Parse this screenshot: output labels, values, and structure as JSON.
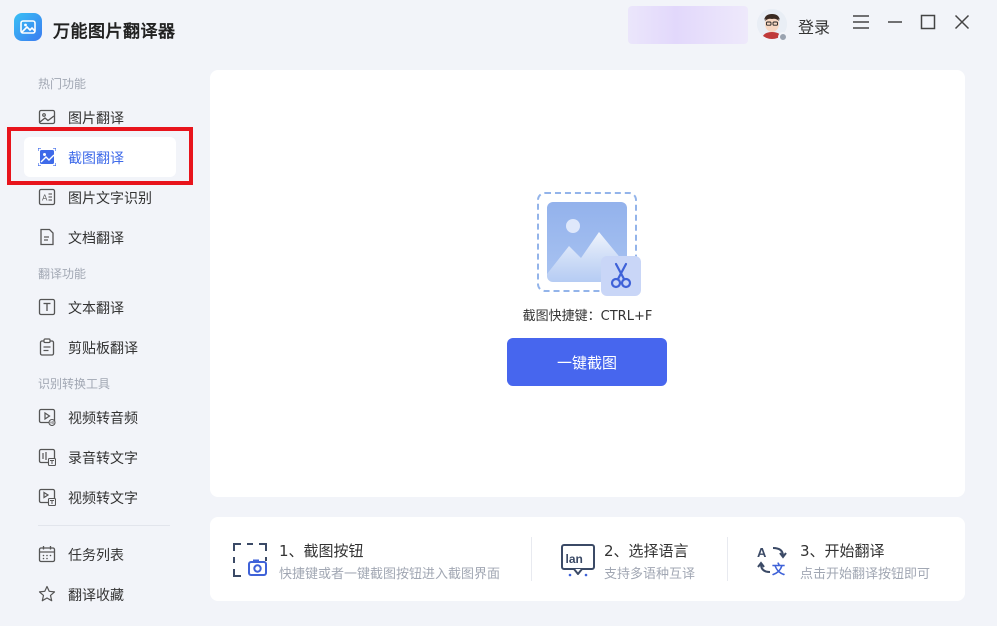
{
  "app": {
    "title": "万能图片翻译器"
  },
  "header": {
    "login_label": "登录"
  },
  "sidebar": {
    "sections": [
      {
        "label": "热门功能"
      },
      {
        "label": "翻译功能"
      },
      {
        "label": "识别转换工具"
      }
    ],
    "items": [
      {
        "label": "图片翻译",
        "icon": "image-icon",
        "active": false
      },
      {
        "label": "截图翻译",
        "icon": "screenshot-icon",
        "active": true
      },
      {
        "label": "图片文字识别",
        "icon": "ocr-icon",
        "active": false
      },
      {
        "label": "文档翻译",
        "icon": "document-icon",
        "active": false
      },
      {
        "label": "文本翻译",
        "icon": "text-icon",
        "active": false
      },
      {
        "label": "剪贴板翻译",
        "icon": "clipboard-icon",
        "active": false
      },
      {
        "label": "视频转音频",
        "icon": "video-audio-icon",
        "active": false
      },
      {
        "label": "录音转文字",
        "icon": "recording-icon",
        "active": false
      },
      {
        "label": "视频转文字",
        "icon": "video-text-icon",
        "active": false
      },
      {
        "label": "任务列表",
        "icon": "calendar-icon",
        "active": false
      },
      {
        "label": "翻译收藏",
        "icon": "star-icon",
        "active": false
      }
    ]
  },
  "main": {
    "shortcut_text": "截图快捷键：CTRL+F",
    "capture_button_label": "一键截图"
  },
  "steps": [
    {
      "title": "1、截图按钮",
      "desc": "快捷键或者一键截图按钮进入截图界面",
      "icon": "screenshot-frame-icon"
    },
    {
      "title": "2、选择语言",
      "desc": "支持多语种互译",
      "icon": "language-icon"
    },
    {
      "title": "3、开始翻译",
      "desc": "点击开始翻译按钮即可",
      "icon": "translate-icon"
    }
  ],
  "colors": {
    "accent": "#4766ee",
    "active_text": "#3e6ae9",
    "highlight": "#e8141c"
  }
}
